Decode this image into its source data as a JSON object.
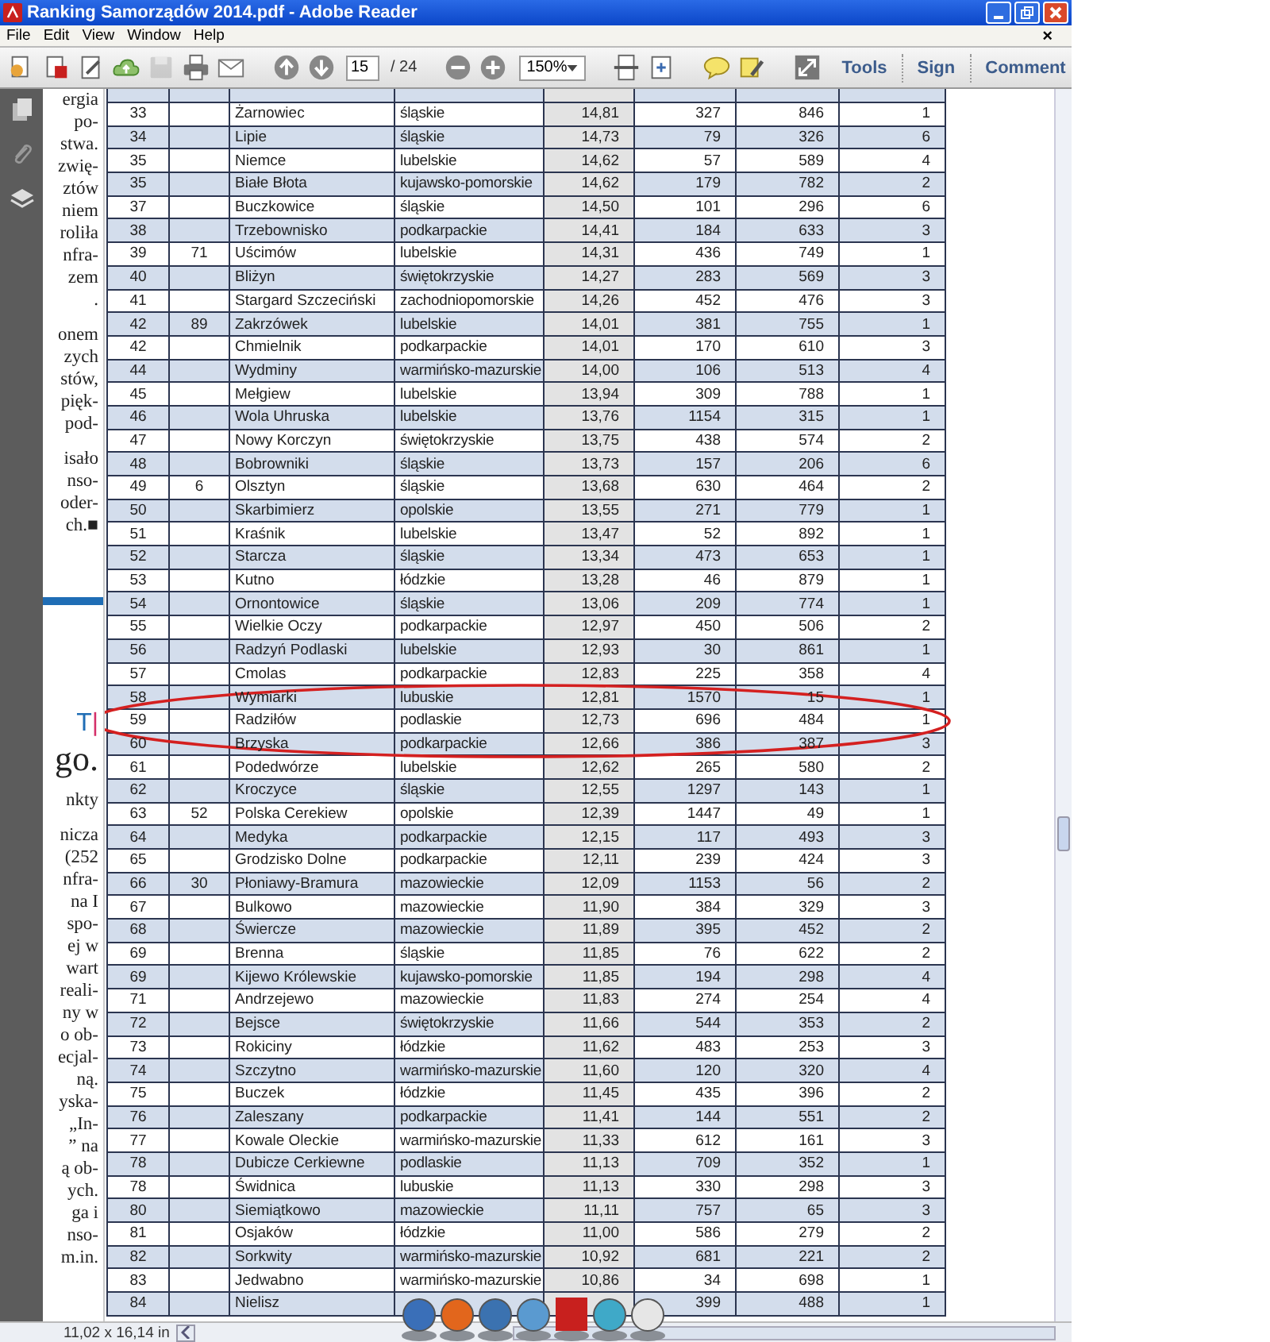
{
  "window": {
    "title": "Ranking Samorządów 2014.pdf - Adobe Reader"
  },
  "menu_bar": {
    "items": [
      "File",
      "Edit",
      "View",
      "Window",
      "Help"
    ],
    "close_mark": "×"
  },
  "toolbar": {
    "save_button": {
      "disabled": true
    },
    "page_number": "15",
    "page_count": "/ 24",
    "zoom": "150%",
    "panels": [
      "Tools",
      "Sign",
      "Comment"
    ]
  },
  "page_fragment": {
    "blocks": [
      {
        "kind": "text",
        "lines": [
          "ergia",
          "po-",
          "stwa.",
          "zwię-",
          "ztów",
          "niem",
          "roliła",
          "nfra-",
          "zem",
          "."
        ]
      },
      {
        "kind": "text",
        "lines": [
          "onem",
          "zych",
          "stów,",
          "pięk-",
          "pod-"
        ]
      },
      {
        "kind": "text",
        "lines": [
          "isało",
          "nso-",
          "oder-",
          "ch.■"
        ]
      },
      {
        "kind": "rule"
      },
      {
        "kind": "heading",
        "letter": "T",
        "mark": "|"
      },
      {
        "kind": "title",
        "text": "go."
      },
      {
        "kind": "text",
        "lines": [
          "nkty"
        ]
      },
      {
        "kind": "text",
        "lines": [
          "nicza",
          "(252",
          "nfra-",
          "na I",
          "spo-",
          "ej w",
          "wart",
          "reali-",
          "ny w",
          "o ob-",
          "ecjal-",
          "ną.",
          "yska-",
          "„In-",
          "” na",
          "ą ob-",
          "ych.",
          "ga i",
          "nso-",
          "m.in."
        ]
      }
    ]
  },
  "table": {
    "rows": [
      {
        "column_1": "33",
        "column_3": "Żarnowiec",
        "column_4": "śląskie",
        "column_5": "14,81",
        "column_6": "327",
        "column_7": "846",
        "column_8": "1"
      },
      {
        "column_1": "34",
        "column_3": "Lipie",
        "column_4": "śląskie",
        "column_5": "14,73",
        "column_6": "79",
        "column_7": "326",
        "column_8": "6"
      },
      {
        "column_1": "35",
        "column_3": "Niemce",
        "column_4": "lubelskie",
        "column_5": "14,62",
        "column_6": "57",
        "column_7": "589",
        "column_8": "4"
      },
      {
        "column_1": "35",
        "column_3": "Białe Błota",
        "column_4": "kujawsko-pomorskie",
        "column_5": "14,62",
        "column_6": "179",
        "column_7": "782",
        "column_8": "2"
      },
      {
        "column_1": "37",
        "column_3": "Buczkowice",
        "column_4": "śląskie",
        "column_5": "14,50",
        "column_6": "101",
        "column_7": "296",
        "column_8": "6"
      },
      {
        "column_1": "38",
        "column_3": "Trzebownisko",
        "column_4": "podkarpackie",
        "column_5": "14,41",
        "column_6": "184",
        "column_7": "633",
        "column_8": "3"
      },
      {
        "column_1": "39",
        "column_2": "71",
        "column_3": "Uścimów",
        "column_4": "lubelskie",
        "column_5": "14,31",
        "column_6": "436",
        "column_7": "749",
        "column_8": "1"
      },
      {
        "column_1": "40",
        "column_3": "Bliżyn",
        "column_4": "świętokrzyskie",
        "column_5": "14,27",
        "column_6": "283",
        "column_7": "569",
        "column_8": "3"
      },
      {
        "column_1": "41",
        "column_3": "Stargard Szczeciński",
        "column_4": "zachodniopomorskie",
        "column_5": "14,26",
        "column_6": "452",
        "column_7": "476",
        "column_8": "3"
      },
      {
        "column_1": "42",
        "column_2": "89",
        "column_3": "Zakrzówek",
        "column_4": "lubelskie",
        "column_5": "14,01",
        "column_6": "381",
        "column_7": "755",
        "column_8": "1"
      },
      {
        "column_1": "42",
        "column_3": "Chmielnik",
        "column_4": "podkarpackie",
        "column_5": "14,01",
        "column_6": "170",
        "column_7": "610",
        "column_8": "3"
      },
      {
        "column_1": "44",
        "column_3": "Wydminy",
        "column_4": "warmińsko-mazurskie",
        "column_5": "14,00",
        "column_6": "106",
        "column_7": "513",
        "column_8": "4"
      },
      {
        "column_1": "45",
        "column_3": "Mełgiew",
        "column_4": "lubelskie",
        "column_5": "13,94",
        "column_6": "309",
        "column_7": "788",
        "column_8": "1"
      },
      {
        "column_1": "46",
        "column_3": "Wola Uhruska",
        "column_4": "lubelskie",
        "column_5": "13,76",
        "column_6": "1154",
        "column_7": "315",
        "column_8": "1"
      },
      {
        "column_1": "47",
        "column_3": "Nowy Korczyn",
        "column_4": "świętokrzyskie",
        "column_5": "13,75",
        "column_6": "438",
        "column_7": "574",
        "column_8": "2"
      },
      {
        "column_1": "48",
        "column_3": "Bobrowniki",
        "column_4": "śląskie",
        "column_5": "13,73",
        "column_6": "157",
        "column_7": "206",
        "column_8": "6"
      },
      {
        "column_1": "49",
        "column_2": "6",
        "column_3": "Olsztyn",
        "column_4": "śląskie",
        "column_5": "13,68",
        "column_6": "630",
        "column_7": "464",
        "column_8": "2"
      },
      {
        "column_1": "50",
        "column_3": "Skarbimierz",
        "column_4": "opolskie",
        "column_5": "13,55",
        "column_6": "271",
        "column_7": "779",
        "column_8": "1"
      },
      {
        "column_1": "51",
        "column_3": "Kraśnik",
        "column_4": "lubelskie",
        "column_5": "13,47",
        "column_6": "52",
        "column_7": "892",
        "column_8": "1"
      },
      {
        "column_1": "52",
        "column_3": "Starcza",
        "column_4": "śląskie",
        "column_5": "13,34",
        "column_6": "473",
        "column_7": "653",
        "column_8": "1"
      },
      {
        "column_1": "53",
        "column_3": "Kutno",
        "column_4": "łódzkie",
        "column_5": "13,28",
        "column_6": "46",
        "column_7": "879",
        "column_8": "1"
      },
      {
        "column_1": "54",
        "column_3": "Ornontowice",
        "column_4": "śląskie",
        "column_5": "13,06",
        "column_6": "209",
        "column_7": "774",
        "column_8": "1"
      },
      {
        "column_1": "55",
        "column_3": "Wielkie Oczy",
        "column_4": "podkarpackie",
        "column_5": "12,97",
        "column_6": "450",
        "column_7": "506",
        "column_8": "2"
      },
      {
        "column_1": "56",
        "column_3": "Radzyń Podlaski",
        "column_4": "lubelskie",
        "column_5": "12,93",
        "column_6": "30",
        "column_7": "861",
        "column_8": "1"
      },
      {
        "column_1": "57",
        "column_3": "Cmolas",
        "column_4": "podkarpackie",
        "column_5": "12,83",
        "column_6": "225",
        "column_7": "358",
        "column_8": "4"
      },
      {
        "column_1": "58",
        "column_3": "Wymiarki",
        "column_4": "lubuskie",
        "column_5": "12,81",
        "column_6": "1570",
        "column_7": "15",
        "column_8": "1"
      },
      {
        "column_1": "59",
        "column_3": "Radziłów",
        "column_4": "podlaskie",
        "column_5": "12,73",
        "column_6": "696",
        "column_7": "484",
        "column_8": "1"
      },
      {
        "column_1": "60",
        "column_3": "Brzyska",
        "column_4": "podkarpackie",
        "column_5": "12,66",
        "column_6": "386",
        "column_7": "387",
        "column_8": "3"
      },
      {
        "column_1": "61",
        "column_3": "Podedwórze",
        "column_4": "lubelskie",
        "column_5": "12,62",
        "column_6": "265",
        "column_7": "580",
        "column_8": "2"
      },
      {
        "column_1": "62",
        "column_3": "Kroczyce",
        "column_4": "śląskie",
        "column_5": "12,55",
        "column_6": "1297",
        "column_7": "143",
        "column_8": "1"
      },
      {
        "column_1": "63",
        "column_2": "52",
        "column_3": "Polska Cerekiew",
        "column_4": "opolskie",
        "column_5": "12,39",
        "column_6": "1447",
        "column_7": "49",
        "column_8": "1"
      },
      {
        "column_1": "64",
        "column_3": "Medyka",
        "column_4": "podkarpackie",
        "column_5": "12,15",
        "column_6": "117",
        "column_7": "493",
        "column_8": "3"
      },
      {
        "column_1": "65",
        "column_3": "Grodzisko Dolne",
        "column_4": "podkarpackie",
        "column_5": "12,11",
        "column_6": "239",
        "column_7": "424",
        "column_8": "3"
      },
      {
        "column_1": "66",
        "column_2": "30",
        "column_3": "Płoniawy-Bramura",
        "column_4": "mazowieckie",
        "column_5": "12,09",
        "column_6": "1153",
        "column_7": "56",
        "column_8": "2"
      },
      {
        "column_1": "67",
        "column_3": "Bulkowo",
        "column_4": "mazowieckie",
        "column_5": "11,90",
        "column_6": "384",
        "column_7": "329",
        "column_8": "3"
      },
      {
        "column_1": "68",
        "column_3": "Świercze",
        "column_4": "mazowieckie",
        "column_5": "11,89",
        "column_6": "395",
        "column_7": "452",
        "column_8": "2"
      },
      {
        "column_1": "69",
        "column_3": "Brenna",
        "column_4": "śląskie",
        "column_5": "11,85",
        "column_6": "76",
        "column_7": "622",
        "column_8": "2"
      },
      {
        "column_1": "69",
        "column_3": "Kijewo Królewskie",
        "column_4": "kujawsko-pomorskie",
        "column_5": "11,85",
        "column_6": "194",
        "column_7": "298",
        "column_8": "4"
      },
      {
        "column_1": "71",
        "column_3": "Andrzejewo",
        "column_4": "mazowieckie",
        "column_5": "11,83",
        "column_6": "274",
        "column_7": "254",
        "column_8": "4"
      },
      {
        "column_1": "72",
        "column_3": "Bejsce",
        "column_4": "świętokrzyskie",
        "column_5": "11,66",
        "column_6": "544",
        "column_7": "353",
        "column_8": "2"
      },
      {
        "column_1": "73",
        "column_3": "Rokiciny",
        "column_4": "łódzkie",
        "column_5": "11,62",
        "column_6": "483",
        "column_7": "253",
        "column_8": "3"
      },
      {
        "column_1": "74",
        "column_3": "Szczytno",
        "column_4": "warmińsko-mazurskie",
        "column_5": "11,60",
        "column_6": "120",
        "column_7": "320",
        "column_8": "4"
      },
      {
        "column_1": "75",
        "column_3": "Buczek",
        "column_4": "łódzkie",
        "column_5": "11,45",
        "column_6": "435",
        "column_7": "396",
        "column_8": "2"
      },
      {
        "column_1": "76",
        "column_3": "Zaleszany",
        "column_4": "podkarpackie",
        "column_5": "11,41",
        "column_6": "144",
        "column_7": "551",
        "column_8": "2"
      },
      {
        "column_1": "77",
        "column_3": "Kowale Oleckie",
        "column_4": "warmińsko-mazurskie",
        "column_5": "11,33",
        "column_6": "612",
        "column_7": "161",
        "column_8": "3"
      },
      {
        "column_1": "78",
        "column_3": "Dubicze Cerkiewne",
        "column_4": "podlaskie",
        "column_5": "11,13",
        "column_6": "709",
        "column_7": "352",
        "column_8": "1"
      },
      {
        "column_1": "78",
        "column_3": "Świdnica",
        "column_4": "lubuskie",
        "column_5": "11,13",
        "column_6": "330",
        "column_7": "298",
        "column_8": "3"
      },
      {
        "column_1": "80",
        "column_3": "Siemiątkowo",
        "column_4": "mazowieckie",
        "column_5": "11,11",
        "column_6": "757",
        "column_7": "65",
        "column_8": "3"
      },
      {
        "column_1": "81",
        "column_3": "Osjaków",
        "column_4": "łódzkie",
        "column_5": "11,00",
        "column_6": "586",
        "column_7": "279",
        "column_8": "2"
      },
      {
        "column_1": "82",
        "column_3": "Sorkwity",
        "column_4": "warmińsko-mazurskie",
        "column_5": "10,92",
        "column_6": "681",
        "column_7": "221",
        "column_8": "2"
      },
      {
        "column_1": "83",
        "column_3": "Jedwabno",
        "column_4": "warmińsko-mazurskie",
        "column_5": "10,86",
        "column_6": "34",
        "column_7": "698",
        "column_8": "1"
      },
      {
        "column_1": "84",
        "column_3": "Nielisz",
        "column_6": "399",
        "column_7": "488",
        "column_8": "1"
      }
    ]
  },
  "status_bar": {
    "page_size": "11,02 x 16,14 in"
  }
}
